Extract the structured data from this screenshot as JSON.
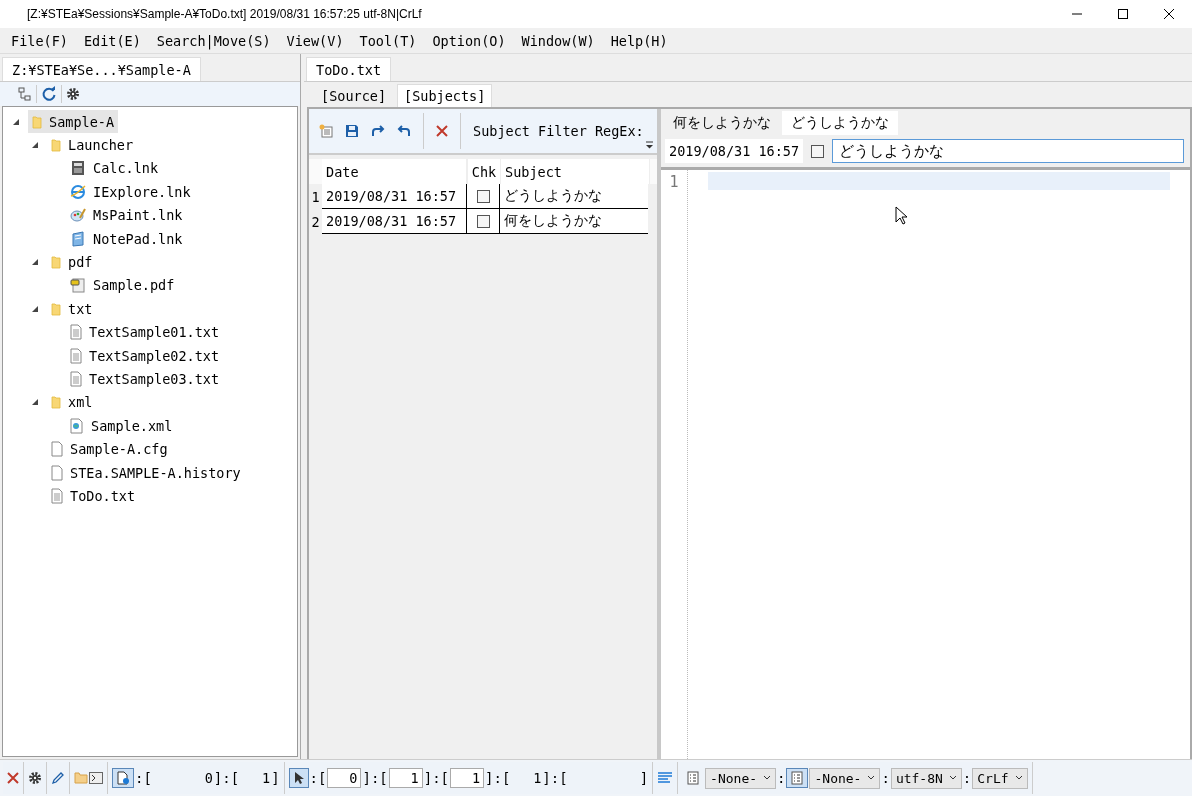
{
  "window": {
    "title": "[Z:¥STEa¥Sessions¥Sample-A¥ToDo.txt] 2019/08/31 16:57:25 utf-8N|CrLf"
  },
  "menu": [
    "File(F)",
    "Edit(E)",
    "Search|Move(S)",
    "View(V)",
    "Tool(T)",
    "Option(O)",
    "Window(W)",
    "Help(H)"
  ],
  "explorer": {
    "tab": "Z:¥STEa¥Se...¥Sample-A",
    "tree": [
      {
        "label": "Sample-A",
        "kind": "folder",
        "expanded": true,
        "selected": true,
        "children": [
          {
            "label": "Launcher",
            "kind": "folder",
            "expanded": true,
            "selected": false,
            "children": [
              {
                "label": "Calc.lnk",
                "kind": "calculator",
                "selected": false
              },
              {
                "label": "IExplore.lnk",
                "kind": "globe",
                "selected": false
              },
              {
                "label": "MsPaint.lnk",
                "kind": "paint",
                "selected": false
              },
              {
                "label": "NotePad.lnk",
                "kind": "notepad",
                "selected": false
              }
            ]
          },
          {
            "label": "pdf",
            "kind": "folder",
            "expanded": true,
            "selected": false,
            "children": [
              {
                "label": "Sample.pdf",
                "kind": "pdf",
                "selected": false
              }
            ]
          },
          {
            "label": "txt",
            "kind": "folder",
            "expanded": true,
            "selected": false,
            "children": [
              {
                "label": "TextSample01.txt",
                "kind": "text",
                "selected": false
              },
              {
                "label": "TextSample02.txt",
                "kind": "text",
                "selected": false
              },
              {
                "label": "TextSample03.txt",
                "kind": "text",
                "selected": false
              }
            ]
          },
          {
            "label": "xml",
            "kind": "folder",
            "expanded": true,
            "selected": false,
            "children": [
              {
                "label": "Sample.xml",
                "kind": "xml",
                "selected": false
              }
            ]
          },
          {
            "label": "Sample-A.cfg",
            "kind": "blank",
            "selected": false
          },
          {
            "label": "STEa.SAMPLE-A.history",
            "kind": "blank",
            "selected": false
          },
          {
            "label": "ToDo.txt",
            "kind": "text",
            "selected": false
          }
        ]
      }
    ]
  },
  "editor": {
    "file_tab": "ToDo.txt",
    "view_tabs": [
      {
        "label": "[Source]",
        "selected": false
      },
      {
        "label": "[Subjects]",
        "selected": true
      }
    ],
    "filter_label": "Subject Filter RegEx:",
    "table": {
      "columns": [
        "Date",
        "Chk",
        "Subject"
      ],
      "rows": [
        {
          "index": "1",
          "date": "2019/08/31 16:57",
          "checked": false,
          "subject": "どうしようかな"
        },
        {
          "index": "2",
          "date": "2019/08/31 16:57",
          "checked": false,
          "subject": "何をしようかな"
        }
      ]
    },
    "subject_tabs": [
      {
        "label": "何をしようかな",
        "selected": false
      },
      {
        "label": "どうしようかな",
        "selected": true
      }
    ],
    "entry": {
      "date": "2019/08/31 16:57",
      "checked": false,
      "value": "どうしようかな"
    },
    "line_numbers": [
      "1"
    ]
  },
  "status_bar": {
    "file_info": {
      "on": true,
      "segments": [
        {
          "kind": "sep",
          "text": ":["
        },
        {
          "kind": "value",
          "text": "0"
        },
        {
          "kind": "sep",
          "text": "]:["
        },
        {
          "kind": "value",
          "text": "1"
        },
        {
          "kind": "sep",
          "text": "]"
        }
      ]
    },
    "cursor": {
      "on": true,
      "segments": [
        {
          "kind": "sep",
          "text": ":["
        },
        {
          "kind": "box",
          "text": "0"
        },
        {
          "kind": "sep",
          "text": "]:["
        },
        {
          "kind": "box",
          "text": "1"
        },
        {
          "kind": "sep",
          "text": "]:["
        },
        {
          "kind": "box",
          "text": "1"
        },
        {
          "kind": "sep",
          "text": "]:["
        },
        {
          "kind": "value",
          "text": "1"
        },
        {
          "kind": "sep",
          "text": "]:["
        },
        {
          "kind": "gap"
        },
        {
          "kind": "sep",
          "text": "]"
        }
      ]
    },
    "selectors": [
      {
        "kind": "toggle",
        "on": false
      },
      {
        "kind": "select",
        "text": "-None-"
      },
      {
        "kind": "sep",
        "text": ":"
      },
      {
        "kind": "toggle",
        "on": true
      },
      {
        "kind": "select",
        "text": "-None-"
      },
      {
        "kind": "sep",
        "text": ":"
      },
      {
        "kind": "select",
        "text": "utf-8N"
      },
      {
        "kind": "sep",
        "text": ":"
      },
      {
        "kind": "select",
        "text": "CrLf"
      }
    ]
  }
}
